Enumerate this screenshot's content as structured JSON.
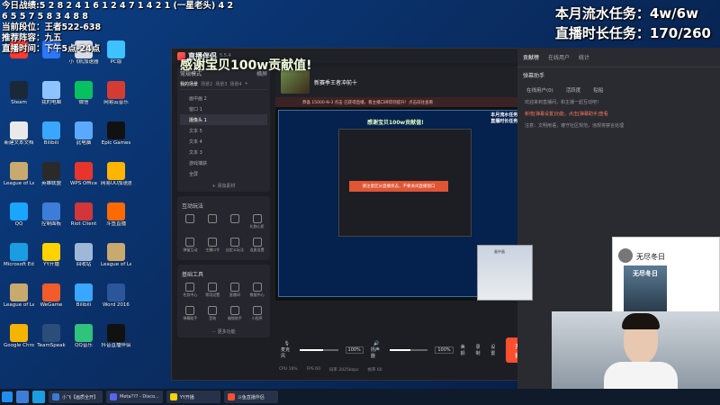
{
  "overlay": {
    "line1": "今日战绩:5 2 8 2 4 1 6 1 2 4 7 1 4 2 1 (一星老头) 4 2",
    "line2": "6 5 5 7 5 8 3 4 8 8",
    "line3": "当前段位：王者522-638",
    "line4": "推荐阵容：九五",
    "line5": "直播时间：下午5点-24点",
    "task_flow": "本月流水任务：4w/6w",
    "task_time": "直播时长任务：170/260"
  },
  "desktop_icons": [
    {
      "label": "",
      "color": "#ff3b30"
    },
    {
      "label": "",
      "color": "#2b78ff"
    },
    {
      "label": "小飞机加速器",
      "color": "#d8dce6"
    },
    {
      "label": "PC版",
      "color": "#3ec2ff"
    },
    {
      "label": "Steam",
      "color": "#1b2838"
    },
    {
      "label": "我的电脑",
      "color": "#8fc3ff"
    },
    {
      "label": "微信",
      "color": "#07c160"
    },
    {
      "label": "网易云音乐",
      "color": "#d43c33"
    },
    {
      "label": "新建文本文档",
      "color": "#e9e9e9"
    },
    {
      "label": "Bilibili",
      "color": "#39a6ff"
    },
    {
      "label": "此电脑",
      "color": "#5aa9ff"
    },
    {
      "label": "Epic Games",
      "color": "#111"
    },
    {
      "label": "League of Legends",
      "color": "#c8aa6e"
    },
    {
      "label": "英雄联盟",
      "color": "#2a2a2a"
    },
    {
      "label": "WPS Office",
      "color": "#e8352c"
    },
    {
      "label": "网易UU加速器",
      "color": "#ffb400"
    },
    {
      "label": "QQ",
      "color": "#1aa5ff"
    },
    {
      "label": "控制面板",
      "color": "#3d7dd8"
    },
    {
      "label": "Riot Client",
      "color": "#d13639"
    },
    {
      "label": "斗鱼直播",
      "color": "#ff6a00"
    },
    {
      "label": "Microsoft Edge",
      "color": "#1b9de2"
    },
    {
      "label": "YY开播",
      "color": "#ffd200"
    },
    {
      "label": "回收站",
      "color": "#9fb8d8"
    },
    {
      "label": "League of Legends",
      "color": "#c8aa6e"
    },
    {
      "label": "League of Legends",
      "color": "#c8aa6e"
    },
    {
      "label": "WeGame",
      "color": "#f25c2a"
    },
    {
      "label": "Bilibili",
      "color": "#39a6ff"
    },
    {
      "label": "Word 2016",
      "color": "#2b579a"
    },
    {
      "label": "Google Chrome",
      "color": "#f4b400"
    },
    {
      "label": "TeamSpeak",
      "color": "#2c4d7a"
    },
    {
      "label": "QQ音乐",
      "color": "#31c27c"
    },
    {
      "label": "抖音直播伴侣",
      "color": "#111"
    }
  ],
  "app": {
    "name": "直播伴侣",
    "version": "5.5.4",
    "banner": "感谢宝贝100w贡献值!",
    "mode": "常规模式",
    "mode_right": "横屏",
    "scene_tabs": [
      "我的场景",
      "场景2",
      "场景3",
      "场景4",
      "+"
    ],
    "sources": [
      "画中画 2",
      "窗口 1",
      "摄像头 1",
      "文本 5",
      "文本 4",
      "文本 3",
      "游戏捕获",
      "全屏"
    ],
    "add_source": "+ 添加素材",
    "interact_title": "互动玩法",
    "interact_items": [
      "",
      "",
      "",
      "礼物心愿",
      "弹窗互动",
      "主播口令",
      "自定义玩法",
      "连麦设置"
    ],
    "tools_title": "基础工具",
    "tools_items": [
      "任务中心",
      "常用设置",
      "直播间",
      "数据中心",
      "弹幕助手",
      "音效",
      "福袋助手",
      "小程序"
    ],
    "more": "··· 更多功能",
    "room_title": "新赛季王者冲前十",
    "notice": "恭喜 15000-N-3 点击 已获得直播，看主播口碑得到提升！点击前往查看",
    "preview_inner_banner": "感谢宝贝100w贡献值!",
    "preview_inner_task1": "本月流水任务：4w/6w",
    "preview_inner_task2": "直播时长任务：170/260",
    "warning": "请注意区分直播状态，不要关闭直播窗口",
    "mic_label": "麦克风",
    "speaker_label": "扬声器",
    "mic_pct": "100%",
    "speaker_pct": "100%",
    "mic_level": 0.6,
    "speaker_level": 0.55,
    "ctrl_a": "美颜",
    "ctrl_b": "录制",
    "ctrl_c": "设置",
    "start_button": "开始直播",
    "status": [
      "CPU 16%",
      "FPS 60",
      "码率 2025kbps",
      "帧率 60"
    ]
  },
  "right_panel": {
    "tabs": [
      "贡献榜",
      "在线用户",
      "统计"
    ],
    "title": "弹幕助手",
    "subtabs": [
      "在线用户(0)",
      "活跃度",
      "贴船"
    ],
    "lines": [
      "欢迎来到直播间，和主播一起互动吧！",
      "新增[弹幕设置]功能，点击[弹幕助手]查看",
      "注意：文明用语，遵守社区规范，违规将禁言处理"
    ]
  },
  "ad": {
    "name": "无尽冬日",
    "pic_text": "无尽冬日"
  },
  "small_cam": {
    "name": "画中画"
  },
  "taskbar": {
    "items": [
      {
        "label": "小飞【画质全开】",
        "color": "#3a7bd5"
      },
      {
        "label": "Meta??? - Disco...",
        "color": "#5865f2"
      },
      {
        "label": "YY开播",
        "color": "#ffd200"
      },
      {
        "label": "斗鱼直播伴侣",
        "color": "#ff4f2e"
      }
    ]
  }
}
